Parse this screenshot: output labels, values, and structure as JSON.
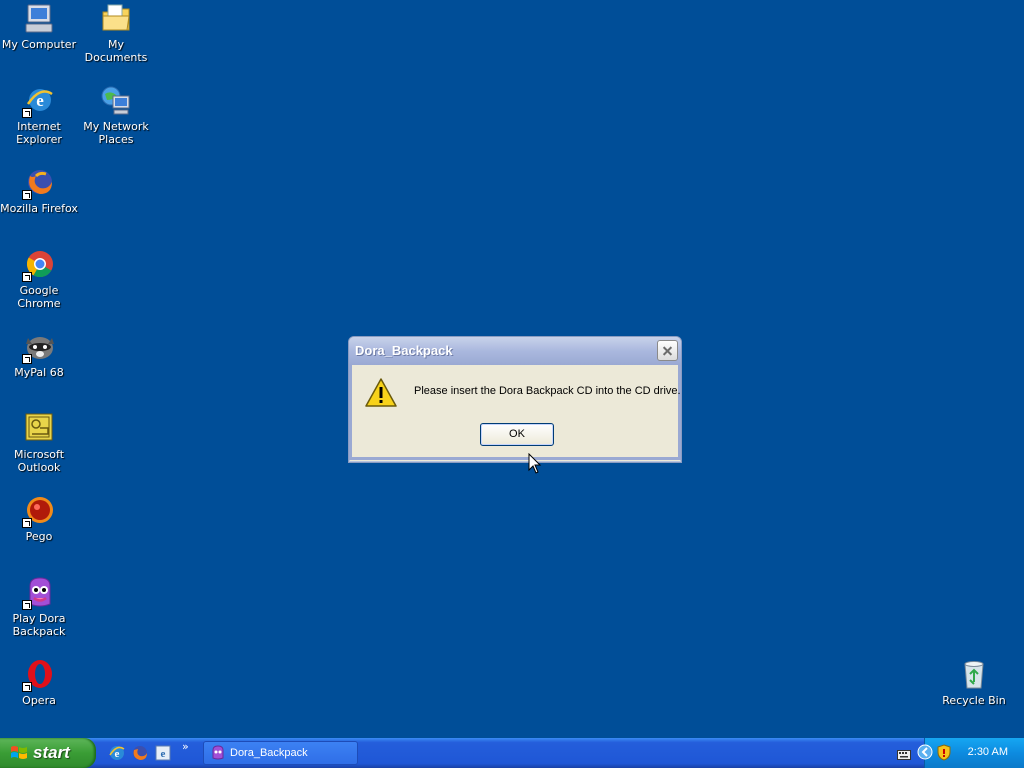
{
  "desktop_icons": [
    {
      "label": "My Computer",
      "icon": "my-computer-icon"
    },
    {
      "label": "My Documents",
      "icon": "my-documents-icon"
    },
    {
      "label": "Internet Explorer",
      "icon": "internet-explorer-icon"
    },
    {
      "label": "My Network Places",
      "icon": "network-places-icon"
    },
    {
      "label": "Mozilla Firefox",
      "icon": "firefox-icon"
    },
    {
      "label": "Google Chrome",
      "icon": "chrome-icon"
    },
    {
      "label": "MyPal 68",
      "icon": "mypal-icon"
    },
    {
      "label": "Microsoft Outlook",
      "icon": "outlook-icon"
    },
    {
      "label": "Pego",
      "icon": "pego-icon"
    },
    {
      "label": "Play Dora Backpack",
      "icon": "dora-icon"
    },
    {
      "label": "Opera",
      "icon": "opera-icon"
    },
    {
      "label": "Recycle Bin",
      "icon": "recycle-bin-icon"
    }
  ],
  "dialog": {
    "title": "Dora_Backpack",
    "message": "Please insert the Dora Backpack CD into the CD drive.",
    "ok_label": "OK",
    "icon": "warning-icon"
  },
  "taskbar": {
    "start_label": "start",
    "quick_launch": [
      "internet-explorer-icon",
      "firefox-icon",
      "ie-alt-icon"
    ],
    "active_task": "Dora_Backpack",
    "clock": "2:30 AM"
  },
  "colors": {
    "desktop": "#004e98",
    "taskbar": "#245edb",
    "start_button": "#3a9d35"
  }
}
